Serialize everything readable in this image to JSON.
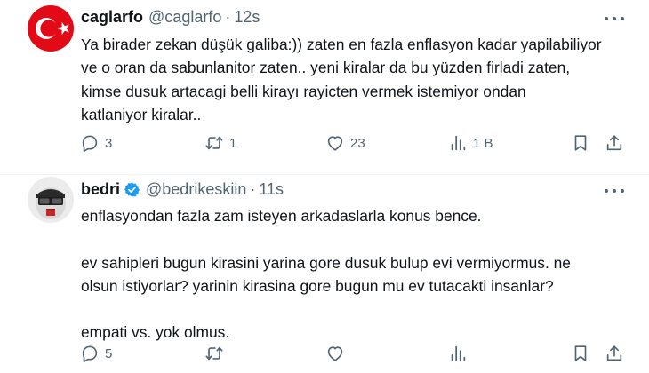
{
  "tweets": [
    {
      "display_name": "caglarfo",
      "handle": "@caglarfo",
      "time": "12s",
      "verified": false,
      "lines": [
        "Ya birader zekan düşük galiba:)) zaten en fazla enflasyon kadar yapilabiliyor",
        "ve o oran da sabunlanitor zaten.. yeni kiralar da bu yüzden firladi zaten,",
        "kimse dusuk artacagi belli  kirayı rayicten vermek istemiyor ondan",
        "katlaniyor kiralar.."
      ],
      "stats": {
        "replies": "3",
        "retweets": "1",
        "likes": "23",
        "views": "1 B"
      }
    },
    {
      "display_name": "bedri",
      "handle": "@bedrikeskiin",
      "time": "11s",
      "verified": true,
      "lines": [
        "enflasyondan fazla zam isteyen arkadaslarla konus bence.",
        "",
        "ev sahipleri bugun kirasini yarina gore dusuk bulup evi vermiyormus. ne",
        "olsun istiyorlar? yarinin kirasina gore bugun mu ev tutacakti insanlar?",
        "",
        "empati vs. yok olmus."
      ],
      "stats": {
        "replies": "5",
        "retweets": "",
        "likes": "",
        "views": ""
      }
    }
  ],
  "separator": "·",
  "colors": {
    "verified": "#1d9bf0",
    "flag_red": "#e30a17",
    "muted": "#536471"
  }
}
